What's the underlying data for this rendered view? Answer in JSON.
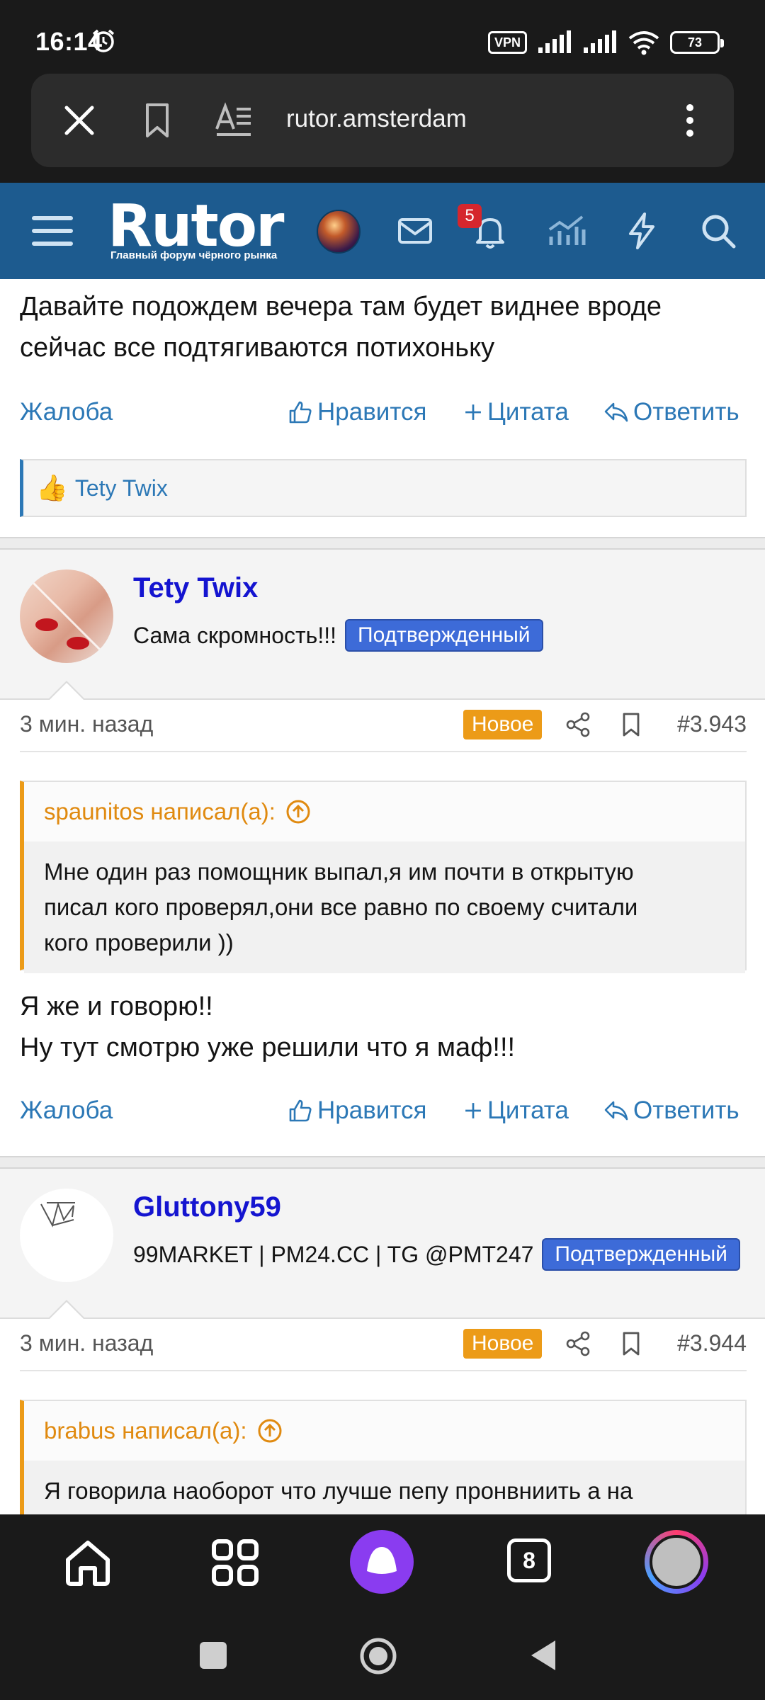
{
  "status_bar": {
    "time": "16:14",
    "vpn": "VPN",
    "battery": "73"
  },
  "browser": {
    "url": "rutor.amsterdam"
  },
  "forum_header": {
    "logo_text": "Rutor",
    "logo_subtitle": "Главный форум чёрного рынка",
    "notifications_count": "5"
  },
  "post_prev": {
    "text_line1": "Давайте подождем вечера там будет виднее вроде",
    "text_line2": "сейчас все подтягиваются потихоньку",
    "liked_by": "Tety Twix"
  },
  "actions": {
    "complain": "Жалоба",
    "like": "Нравится",
    "quote": "Цитата",
    "reply": "Ответить"
  },
  "posts": [
    {
      "username": "Tety Twix",
      "user_title": "Сама скромность!!!",
      "badge": "Подтвержденный",
      "time_ago": "3 мин. назад",
      "new_label": "Новое",
      "post_number": "#3.943",
      "quote_author": "spaunitos написал(а):",
      "quote_line1": "Мне один раз помощник выпал,я им почти в открытую",
      "quote_line2": "писал кого проверял,они все равно по своему считали",
      "quote_line3": "кого проверили ))",
      "text_line1": "Я же и говорю!!",
      "text_line2": "Ну тут смотрю уже решили что я маф!!!"
    },
    {
      "username": "Gluttony59",
      "user_title": "99MARKET | PM24.CC | TG @PMT247",
      "badge": "Подтвержденный",
      "time_ago": "3 мин. назад",
      "new_label": "Новое",
      "post_number": "#3.944",
      "quote_author": "brabus написал(а):",
      "quote_line1": "Я говорила наоборот что лучше пепу пронвниить а на"
    }
  ],
  "bottom_nav": {
    "tabs_count": "8"
  },
  "colors": {
    "header_bg": "#1d5b8f",
    "link": "#2c78b6",
    "accent_orange": "#ec9b18",
    "username": "#1414d0",
    "badge_blue": "#3d6bd8"
  }
}
